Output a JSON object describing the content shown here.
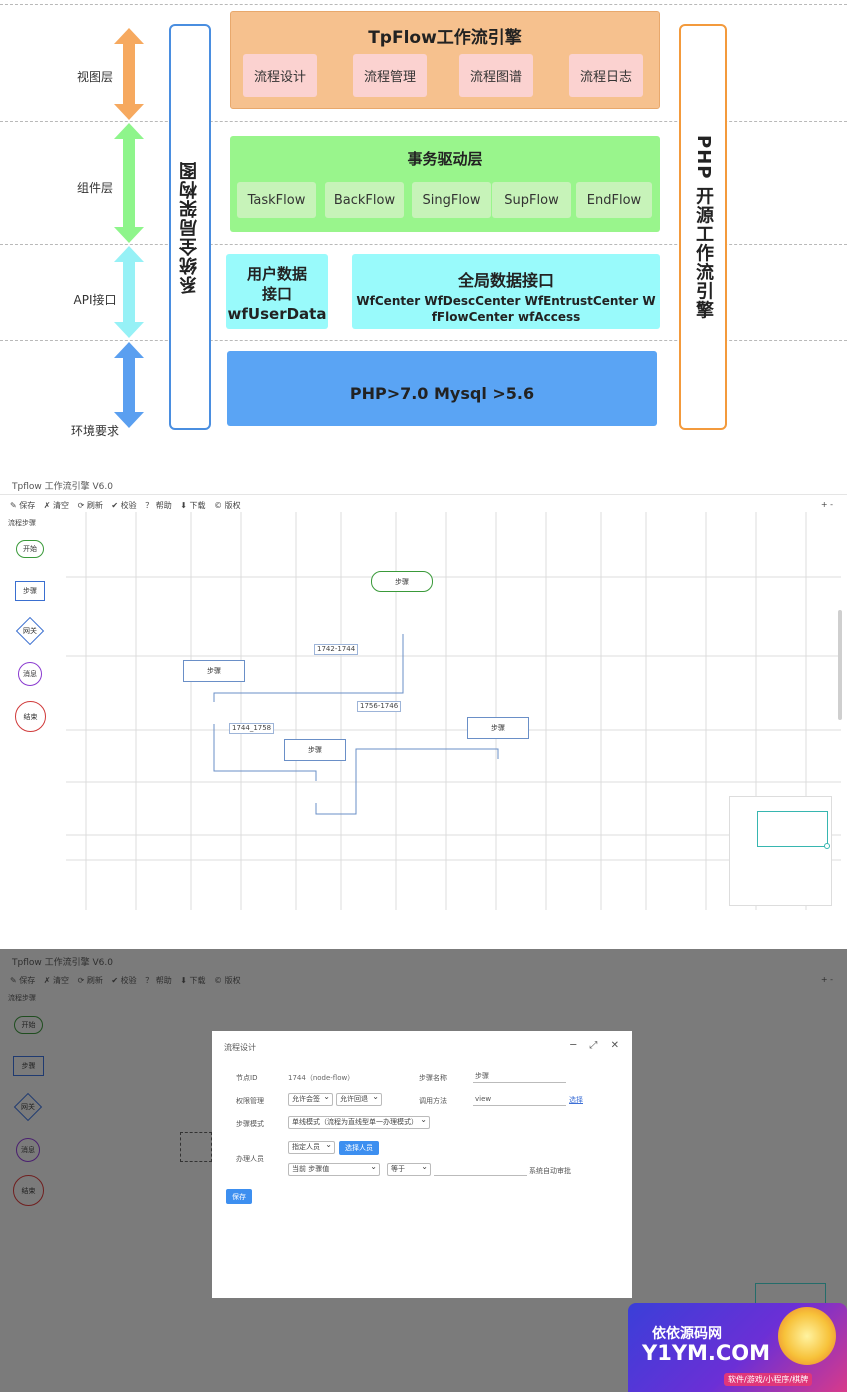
{
  "diagram": {
    "layers": [
      "视图层",
      "组件层",
      "API接口",
      "环境要求"
    ],
    "left_vertical": "系统全局架构图",
    "right_vertical": "PHP 开源工作流引擎",
    "view_panel": {
      "title": "TpFlow工作流引擎",
      "items": [
        "流程设计",
        "流程管理",
        "流程图谱",
        "流程日志"
      ]
    },
    "component_panel": {
      "title": "事务驱动层",
      "items": [
        "TaskFlow",
        "BackFlow",
        "SingFlow",
        "SupFlow",
        "EndFlow"
      ]
    },
    "user_data": {
      "line1": "用户数据",
      "line2": "接口",
      "line3": "wfUserData"
    },
    "global_api": {
      "title": "全局数据接口",
      "line1": "WfCenter WfDescCenter WfEntrustCenter W",
      "line2": "fFlowCenter wfAccess"
    },
    "env": "PHP>7.0 Mysql >5.6",
    "colors": {
      "view": "#f6c18e",
      "view_chip": "#fbd2d0",
      "component": "#99f58c",
      "component_chip": "#c7f3b9",
      "api": "#99fafb",
      "env": "#5aa4f4",
      "left_border": "#4a8ee0",
      "right_border": "#f39a3c"
    }
  },
  "editor1": {
    "title": "Tpflow 工作流引擎 V6.0",
    "toolbar": [
      "✎ 保存",
      "✗ 清空",
      "⟳ 刷新",
      "✔ 校验",
      "？ 帮助",
      "⬇ 下载",
      "© 版权"
    ],
    "toolbar_right": "+  -",
    "palette_title": "流程步骤",
    "palette": [
      "开始",
      "步骤",
      "网关",
      "消息",
      "结束"
    ],
    "nodes": [
      "步骤",
      "步骤",
      "步骤",
      "步骤"
    ],
    "edge_labels": [
      "1742-1744",
      "1744_1758",
      "1756-1746"
    ]
  },
  "editor2": {
    "title": "Tpflow 工作流引擎 V6.0",
    "toolbar": [
      "✎ 保存",
      "✗ 清空",
      "⟳ 刷新",
      "✔ 校验",
      "？ 帮助",
      "⬇ 下载",
      "© 版权"
    ],
    "toolbar_right": "+  -",
    "palette_title": "流程步骤",
    "palette": [
      "开始",
      "步骤",
      "网关",
      "消息",
      "结束"
    ],
    "modal": {
      "title": "流程设计",
      "controls": "─ ⤢ ✕",
      "node_id_label": "节点ID",
      "node_id_value": "1744（node-flow）",
      "step_name_label": "步骤名称",
      "step_name_value": "步骤",
      "perm_label": "权限管理",
      "perm_sel1": "允许会签",
      "perm_sel2": "允许回退",
      "call_label": "调用方法",
      "call_value": "view",
      "call_link": "选择",
      "mode_label": "步骤模式",
      "mode_sel": "单线模式（流程为直线型单一办理模式）",
      "handler_label": "办理人员",
      "handler_sel": "指定人员",
      "handler_btn": "选择人员",
      "cond_sel1": "当前 步骤值",
      "cond_sel2": "等于",
      "cond_suffix": "系统自动审批",
      "save": "保存"
    }
  },
  "watermark": {
    "line1": "依依源码网",
    "line2": "Y1YM.COM",
    "line3": "软件/游戏/小程序/棋牌"
  }
}
